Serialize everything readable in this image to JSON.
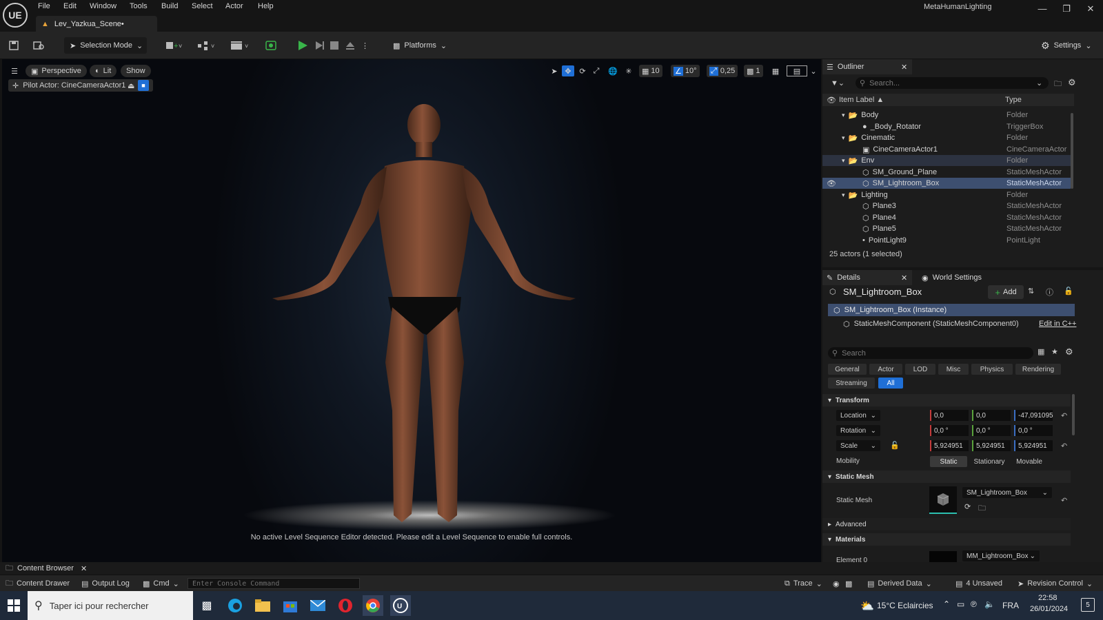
{
  "app": {
    "logo": "UE",
    "project_name": "MetaHumanLighting",
    "level_tab": "Lev_Yazkua_Scene•",
    "menu": [
      "File",
      "Edit",
      "Window",
      "Tools",
      "Build",
      "Select",
      "Actor",
      "Help"
    ]
  },
  "toolbar": {
    "selection_mode": "Selection Mode",
    "platforms": "Platforms",
    "settings": "Settings"
  },
  "viewport": {
    "view_mode": "Perspective",
    "lighting_mode": "Lit",
    "show": "Show",
    "pilot_actor": "Pilot Actor: CineCameraActor1",
    "grid_snap": "10",
    "rotation_snap": "10°",
    "scale_snap": "0,25",
    "camera_speed": "1",
    "message": "No active Level Sequence Editor detected. Please edit a Level Sequence to enable full controls."
  },
  "outliner": {
    "tab": "Outliner",
    "search_placeholder": "Search...",
    "col_label": "Item Label ▲",
    "col_type": "Type",
    "rows": [
      {
        "name": "Body",
        "type": "Folder"
      },
      {
        "name": "_Body_Rotator",
        "type": "TriggerBox"
      },
      {
        "name": "Cinematic",
        "type": "Folder"
      },
      {
        "name": "CineCameraActor1",
        "type": "CineCameraActor"
      },
      {
        "name": "Env",
        "type": "Folder"
      },
      {
        "name": "SM_Ground_Plane",
        "type": "StaticMeshActor"
      },
      {
        "name": "SM_Lightroom_Box",
        "type": "StaticMeshActor"
      },
      {
        "name": "Lighting",
        "type": "Folder"
      },
      {
        "name": "Plane3",
        "type": "StaticMeshActor"
      },
      {
        "name": "Plane4",
        "type": "StaticMeshActor"
      },
      {
        "name": "Plane5",
        "type": "StaticMeshActor"
      },
      {
        "name": "PointLight9",
        "type": "PointLight"
      }
    ],
    "count": "25 actors (1 selected)"
  },
  "details": {
    "tab": "Details",
    "world_tab": "World Settings",
    "title": "SM_Lightroom_Box",
    "add": "Add",
    "instance": "SM_Lightroom_Box (Instance)",
    "component": "StaticMeshComponent (StaticMeshComponent0)",
    "edit_cpp": "Edit in C++",
    "search_placeholder": "Search",
    "filters": [
      "General",
      "Actor",
      "LOD",
      "Misc",
      "Physics",
      "Rendering",
      "Streaming",
      "All"
    ],
    "transform": {
      "header": "Transform",
      "location": {
        "label": "Location",
        "x": "0,0",
        "y": "0,0",
        "z": "-47,091095"
      },
      "rotation": {
        "label": "Rotation",
        "x": "0,0 °",
        "y": "0,0 °",
        "z": "0,0 °"
      },
      "scale": {
        "label": "Scale",
        "x": "5,924951",
        "y": "5,924951",
        "z": "5,924951"
      },
      "mobility_label": "Mobility",
      "mobility": [
        "Static",
        "Stationary",
        "Movable"
      ]
    },
    "static_mesh": {
      "header": "Static Mesh",
      "label": "Static Mesh",
      "asset": "SM_Lightroom_Box"
    },
    "advanced": "Advanced",
    "materials": {
      "header": "Materials",
      "element": "Element 0",
      "asset": "MM_Lightroom_Box"
    }
  },
  "bottom": {
    "content_browser": "Content Browser",
    "content_drawer": "Content Drawer",
    "output_log": "Output Log",
    "cmd": "Cmd",
    "console_placeholder": "Enter Console Command",
    "trace": "Trace",
    "derived_data": "Derived Data",
    "unsaved": "4 Unsaved",
    "revision_control": "Revision Control"
  },
  "taskbar": {
    "search": "Taper ici pour rechercher",
    "weather": "15°C  Eclaircies",
    "lang": "FRA",
    "time": "22:58",
    "date": "26/01/2024",
    "notif": "5"
  },
  "colors": {
    "accent": "#1f6fd6",
    "selection": "#3d4f70",
    "play": "#39b54a"
  }
}
